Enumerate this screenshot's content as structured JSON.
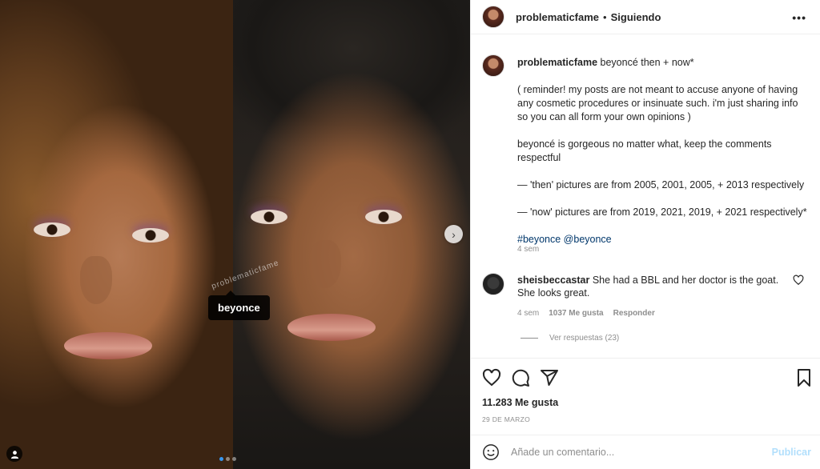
{
  "media": {
    "tag_label": "beyonce",
    "watermark": "problematicfame",
    "carousel_dots": 3,
    "active_dot": 0
  },
  "header": {
    "username": "problematicfame",
    "separator": "•",
    "follow_status": "Siguiendo",
    "more_icon": "more-horizontal-icon"
  },
  "caption": {
    "username": "problematicfame",
    "title": "beyoncé then + now*",
    "paragraphs": [
      "( reminder! my posts are not meant to accuse anyone of having any cosmetic procedures or insinuate such. i'm just sharing info so you can all form your own opinions )",
      "beyoncé is gorgeous no matter what, keep the comments respectful",
      "— 'then' pictures are from 2005, 2001, 2005, + 2013 respectively",
      "— 'now' pictures are from 2019, 2021, 2019, + 2021 respectively*"
    ],
    "tags": "#beyonce @beyonce",
    "time": "4 sem"
  },
  "comment": {
    "username": "sheisbeccastar",
    "text": "She had a BBL and her doctor is the goat. She looks great.",
    "time": "4 sem",
    "likes": "1037 Me gusta",
    "reply": "Responder",
    "view_replies": "Ver respuestas (23)"
  },
  "actions": {
    "icons": [
      "heart-icon",
      "comment-icon",
      "share-icon",
      "bookmark-icon"
    ],
    "likes_count": "11.283 Me gusta",
    "date": "29 DE MARZO"
  },
  "comment_box": {
    "placeholder": "Añade un comentario...",
    "publish": "Publicar"
  },
  "colors": {
    "link": "#00376b",
    "muted": "#8e8e8e",
    "publish_disabled": "#b2dffc",
    "border": "#efefef"
  }
}
